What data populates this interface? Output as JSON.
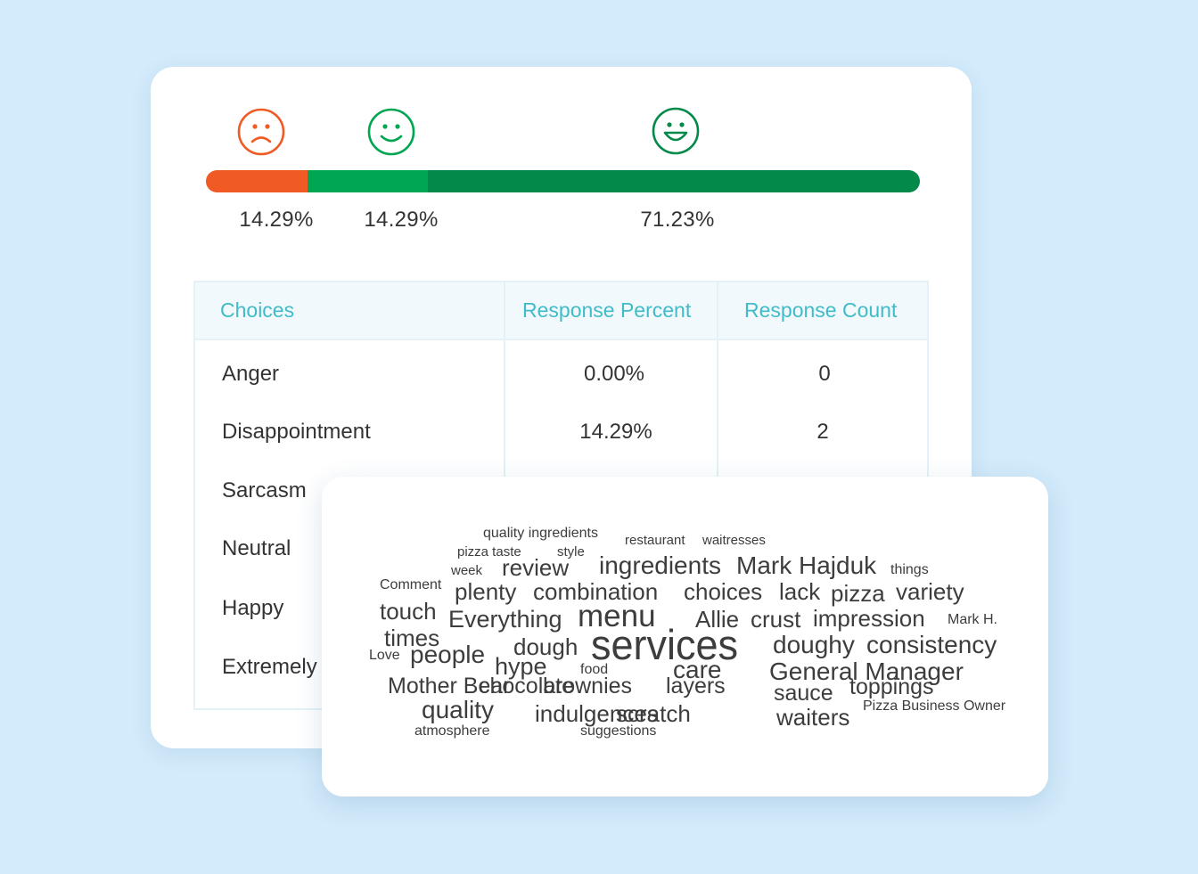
{
  "sentiment": {
    "segments": [
      {
        "label": "Disappointment",
        "percent_text": "14.29%",
        "fraction": 0.1429,
        "color": "#f05a24",
        "face": "sad-face-icon"
      },
      {
        "label": "Neutral / Happy",
        "percent_text": "14.29%",
        "fraction": 0.1685,
        "color": "#00a651",
        "face": "smile-face-icon"
      },
      {
        "label": "Extremely Happy",
        "percent_text": "71.23%",
        "fraction": 0.6886,
        "color": "#03894a",
        "face": "grin-face-icon"
      }
    ]
  },
  "table": {
    "headers": {
      "choices": "Choices",
      "response_percent": "Response Percent",
      "response_count": "Response Count"
    },
    "rows": [
      {
        "choice": "Anger",
        "percent": "0.00%",
        "count": "0"
      },
      {
        "choice": "Disappointment",
        "percent": "14.29%",
        "count": "2"
      },
      {
        "choice": "Sarcasm",
        "percent": "",
        "count": ""
      },
      {
        "choice": "Neutral",
        "percent": "",
        "count": ""
      },
      {
        "choice": "Happy",
        "percent": "",
        "count": ""
      },
      {
        "choice": "Extremely",
        "percent": "",
        "count": ""
      }
    ]
  },
  "word_cloud": {
    "words": [
      "quality ingredients",
      "restaurant",
      "waitresses",
      "pizza taste",
      "style",
      "week",
      "review",
      "ingredients",
      "Mark Hajduk",
      "things",
      "Comment",
      "plenty",
      "combination",
      "choices",
      "lack",
      "pizza",
      "variety",
      "touch",
      "Everything",
      "menu",
      "Allie",
      "crust",
      "impression",
      "Mark H.",
      "times",
      "dough",
      "services",
      "doughy",
      "consistency",
      "Love",
      "people",
      "hype",
      "food",
      "care",
      "General Manager",
      "Mother Bear",
      "chocolate",
      "brownies",
      "layers",
      "sauce",
      "toppings",
      "quality",
      "indulgences",
      "scratch",
      "waiters",
      "Pizza Business Owner",
      "atmosphere",
      "suggestions"
    ]
  }
}
